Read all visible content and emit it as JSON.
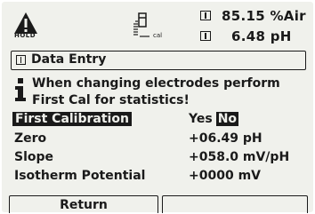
{
  "status": {
    "hold_label": "HOLD",
    "cal_label": "cal",
    "reading1_value": "85.15 %Air",
    "reading2_value": "6.48 pH"
  },
  "title": "Data Entry",
  "message": {
    "line1": "When changing electrodes perform",
    "line2": "First Cal for statistics!"
  },
  "rows": {
    "first_calibration": {
      "label": "First Calibration",
      "opt_yes": "Yes",
      "opt_no": "No",
      "selected": "No"
    },
    "zero": {
      "label": "Zero",
      "value": "+06.49 pH"
    },
    "slope": {
      "label": "Slope",
      "value": "+058.0 mV/pH"
    },
    "isotherm": {
      "label": "Isotherm Potential",
      "value": "+0000 mV"
    }
  },
  "softkeys": {
    "left": "Return",
    "right": ""
  },
  "colors": {
    "screen_bg": "#f0f1ec",
    "ink": "#1a1a1a"
  }
}
